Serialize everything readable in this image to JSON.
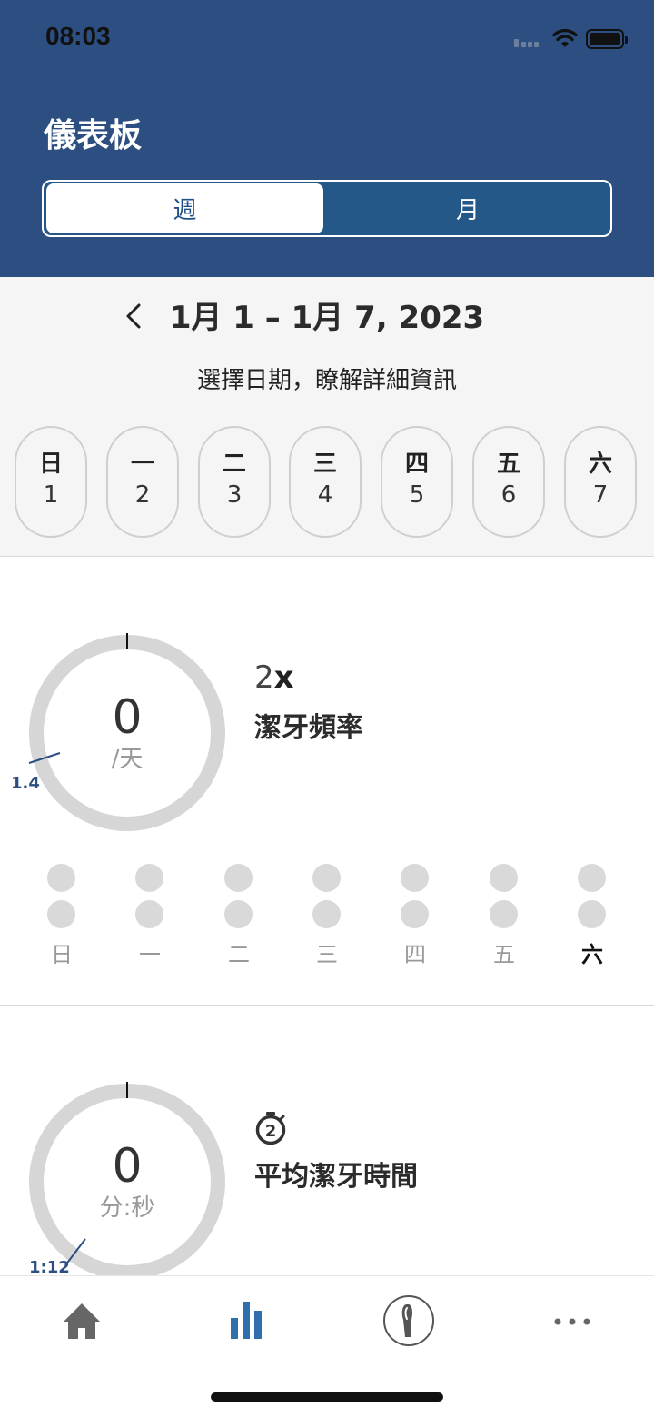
{
  "status_bar": {
    "time": "08:03"
  },
  "header": {
    "title": "儀表板",
    "segments": {
      "week": "週",
      "month": "月"
    }
  },
  "date_selector": {
    "range": "1月 1 – 1月 7, 2023",
    "hint": "選擇日期，瞭解詳細資訊",
    "days": [
      {
        "dow": "日",
        "dom": "1"
      },
      {
        "dow": "一",
        "dom": "2"
      },
      {
        "dow": "二",
        "dom": "3"
      },
      {
        "dow": "三",
        "dom": "4"
      },
      {
        "dow": "四",
        "dom": "5"
      },
      {
        "dow": "五",
        "dom": "6"
      },
      {
        "dow": "六",
        "dom": "7"
      }
    ]
  },
  "frequency": {
    "value": "0",
    "unit": "/天",
    "target": "1.4",
    "count_num": "2",
    "count_x": "x",
    "title": "潔牙頻率",
    "weekdays": [
      "日",
      "一",
      "二",
      "三",
      "四",
      "五",
      "六"
    ],
    "current_day": "六"
  },
  "duration": {
    "value": "0",
    "unit": "分:秒",
    "target": "1:12",
    "title": "平均潔牙時間"
  },
  "tab_bar": {
    "items": [
      "home-icon",
      "stats-icon",
      "toothbrush-icon",
      "more-icon"
    ],
    "active": "stats-icon"
  },
  "colors": {
    "header": "#2c4e80",
    "accent": "#2f6fae",
    "ring": "#d6d6d6"
  }
}
